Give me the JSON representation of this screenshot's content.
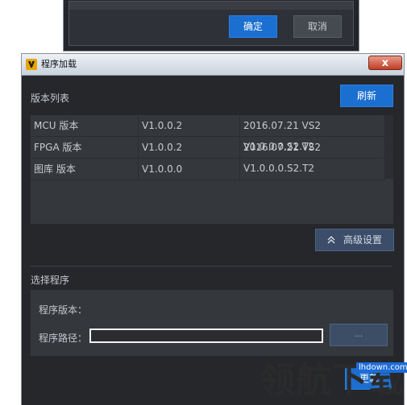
{
  "background_dialog": {
    "confirm_label": "确定",
    "cancel_label": "取消"
  },
  "window": {
    "title": "程序加载",
    "close_label": "x"
  },
  "version_list": {
    "section_title": "版本列表",
    "refresh_label": "刷新",
    "rows": [
      {
        "name": "MCU 版本",
        "version": "V1.0.0.2",
        "detail": "2016.07.21 VS2 V1.0.0.0.S2.T2"
      },
      {
        "name": "FPGA 版本",
        "version": "V1.0.0.2",
        "detail": "2016.07.21 VS2 V1.0.0.0.S2.T2"
      },
      {
        "name": "图库 版本",
        "version": "V1.0.0.0",
        "detail": ""
      }
    ]
  },
  "advanced": {
    "label": "高级设置"
  },
  "program_select": {
    "section_title": "选择程序",
    "version_label": "程序版本：",
    "path_label": "程序路径：",
    "path_value": "",
    "browse_label": "...",
    "update_label": "更新"
  },
  "watermark": {
    "logo": "领航下载",
    "site": "lhdown.com"
  },
  "colors": {
    "accent_blue": "#1b6fd0",
    "panel_bg": "#34373c",
    "window_bg": "#25272b"
  }
}
